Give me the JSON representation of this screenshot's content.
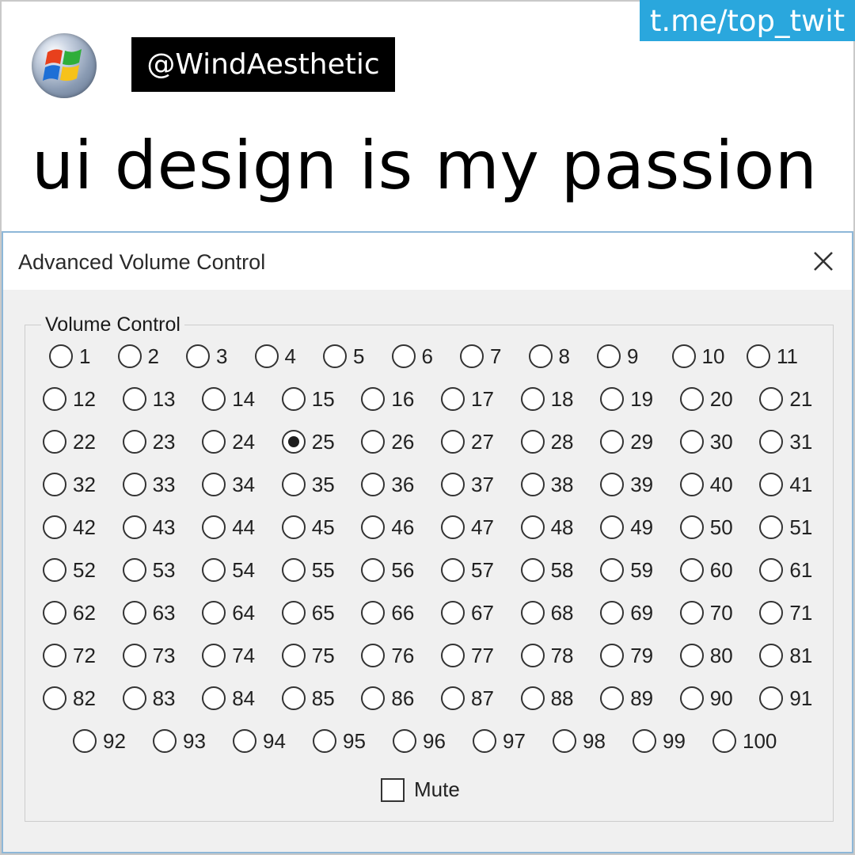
{
  "post": {
    "channel": "t.me/top_twit",
    "handle": "@WindAesthetic",
    "avatar_icon": "windows-xp-logo-icon",
    "caption": "ui design is my passion"
  },
  "dialog": {
    "title": "Advanced Volume Control",
    "close_icon": "close-icon",
    "group_label": "Volume Control",
    "options": [
      "1",
      "2",
      "3",
      "4",
      "5",
      "6",
      "7",
      "8",
      "9",
      "10",
      "11",
      "12",
      "13",
      "14",
      "15",
      "16",
      "17",
      "18",
      "19",
      "20",
      "21",
      "22",
      "23",
      "24",
      "25",
      "26",
      "27",
      "28",
      "29",
      "30",
      "31",
      "32",
      "33",
      "34",
      "35",
      "36",
      "37",
      "38",
      "39",
      "40",
      "41",
      "42",
      "43",
      "44",
      "45",
      "46",
      "47",
      "48",
      "49",
      "50",
      "51",
      "52",
      "53",
      "54",
      "55",
      "56",
      "57",
      "58",
      "59",
      "60",
      "61",
      "62",
      "63",
      "64",
      "65",
      "66",
      "67",
      "68",
      "69",
      "70",
      "71",
      "72",
      "73",
      "74",
      "75",
      "76",
      "77",
      "78",
      "79",
      "80",
      "81",
      "82",
      "83",
      "84",
      "85",
      "86",
      "87",
      "88",
      "89",
      "90",
      "91",
      "92",
      "93",
      "94",
      "95",
      "96",
      "97",
      "98",
      "99",
      "100"
    ],
    "selected": "25",
    "mute_label": "Mute",
    "mute_checked": false
  },
  "colors": {
    "channel_bg": "#2aa7dd",
    "dialog_bg": "#f0f0f0",
    "dialog_border": "#8db7d8"
  }
}
